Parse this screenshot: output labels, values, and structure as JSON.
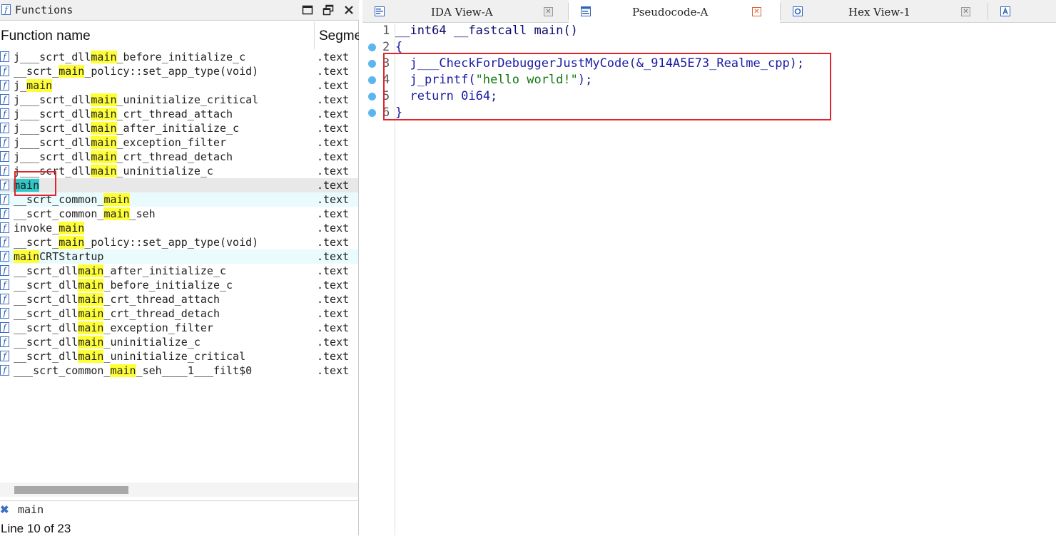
{
  "functions_panel": {
    "title": "Functions",
    "columns": {
      "name": "Function name",
      "segment": "Segment"
    },
    "rows": [
      {
        "pre": "j___scrt_dll",
        "hl": "main",
        "post": "_before_initialize_c",
        "seg": ".text"
      },
      {
        "pre": "__scrt_",
        "hl": "main",
        "post": "_policy::set_app_type(void)",
        "seg": ".text"
      },
      {
        "pre": "j_",
        "hl": "main",
        "post": "",
        "seg": ".text"
      },
      {
        "pre": "j___scrt_dll",
        "hl": "main",
        "post": "_uninitialize_critical",
        "seg": ".text"
      },
      {
        "pre": "j___scrt_dll",
        "hl": "main",
        "post": "_crt_thread_attach",
        "seg": ".text"
      },
      {
        "pre": "j___scrt_dll",
        "hl": "main",
        "post": "_after_initialize_c",
        "seg": ".text"
      },
      {
        "pre": "j___scrt_dll",
        "hl": "main",
        "post": "_exception_filter",
        "seg": ".text"
      },
      {
        "pre": "j___scrt_dll",
        "hl": "main",
        "post": "_crt_thread_detach",
        "seg": ".text"
      },
      {
        "pre": "j___scrt_dll",
        "hl": "main",
        "post": "_uninitialize_c",
        "seg": ".text"
      },
      {
        "pre": "",
        "hl": "main",
        "post": "",
        "seg": ".text"
      },
      {
        "pre": "__scrt_common_",
        "hl": "main",
        "post": "",
        "seg": ".text"
      },
      {
        "pre": "__scrt_common_",
        "hl": "main",
        "post": "_seh",
        "seg": ".text"
      },
      {
        "pre": "invoke_",
        "hl": "main",
        "post": "",
        "seg": ".text"
      },
      {
        "pre": "__scrt_",
        "hl": "main",
        "post": "_policy::set_app_type(void)",
        "seg": ".text"
      },
      {
        "pre": "",
        "hl": "main",
        "post": "CRTStartup",
        "seg": ".text"
      },
      {
        "pre": "__scrt_dll",
        "hl": "main",
        "post": "_after_initialize_c",
        "seg": ".text"
      },
      {
        "pre": "__scrt_dll",
        "hl": "main",
        "post": "_before_initialize_c",
        "seg": ".text"
      },
      {
        "pre": "__scrt_dll",
        "hl": "main",
        "post": "_crt_thread_attach",
        "seg": ".text"
      },
      {
        "pre": "__scrt_dll",
        "hl": "main",
        "post": "_crt_thread_detach",
        "seg": ".text"
      },
      {
        "pre": "__scrt_dll",
        "hl": "main",
        "post": "_exception_filter",
        "seg": ".text"
      },
      {
        "pre": "__scrt_dll",
        "hl": "main",
        "post": "_uninitialize_c",
        "seg": ".text"
      },
      {
        "pre": "__scrt_dll",
        "hl": "main",
        "post": "_uninitialize_critical",
        "seg": ".text"
      },
      {
        "pre": "___scrt_common_",
        "hl": "main",
        "post": "_seh____1___filt$0",
        "seg": ".text"
      }
    ],
    "selected_row_index": 9,
    "hover_row_indices": [
      10,
      14
    ],
    "search_text": "main",
    "status": "Line 10 of 23"
  },
  "tabs": [
    {
      "label": "IDA View-A",
      "icon": "disassembly-icon",
      "active": false
    },
    {
      "label": "Pseudocode-A",
      "icon": "pseudocode-icon",
      "active": true
    },
    {
      "label": "Hex View-1",
      "icon": "hex-icon",
      "active": false
    },
    {
      "label": "",
      "icon": "structures-icon",
      "active": false
    }
  ],
  "pseudocode": {
    "lines": [
      {
        "num": "1",
        "bp": false,
        "parts": [
          {
            "t": "__int64 __fastcall main()",
            "c": "dark"
          }
        ]
      },
      {
        "num": "2",
        "bp": true,
        "parts": [
          {
            "t": "{",
            "c": "navy"
          }
        ]
      },
      {
        "num": "3",
        "bp": true,
        "parts": [
          {
            "t": "  j___CheckForDebuggerJustMyCode(&_914A5E73_Realme_cpp);",
            "c": "navy"
          }
        ]
      },
      {
        "num": "4",
        "bp": true,
        "parts": [
          {
            "t": "  j_printf(",
            "c": "navy"
          },
          {
            "t": "\"hello world!\"",
            "c": "green"
          },
          {
            "t": ");",
            "c": "navy"
          }
        ]
      },
      {
        "num": "5",
        "bp": true,
        "parts": [
          {
            "t": "  return 0i64;",
            "c": "navy"
          }
        ]
      },
      {
        "num": "6",
        "bp": true,
        "parts": [
          {
            "t": "}",
            "c": "navy"
          }
        ]
      }
    ]
  },
  "colors": {
    "highlight": "#ffff38",
    "selected_highlight": "#2fc7c7",
    "annotation_red": "#e1242b",
    "breakpoint": "#5cb6ee"
  }
}
